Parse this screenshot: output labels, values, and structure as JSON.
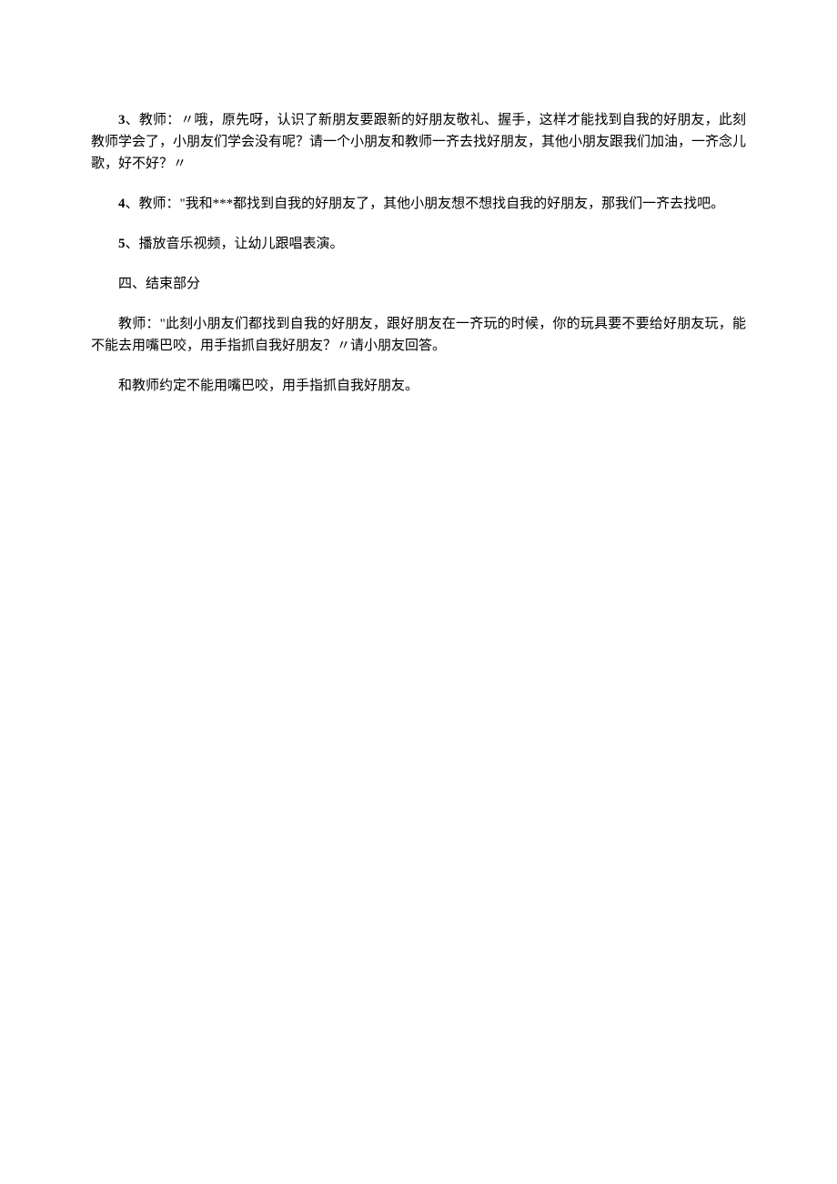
{
  "paragraphs": {
    "p1_num": "3",
    "p1_text": "、教师：〃哦，原先呀，认识了新朋友要跟新的好朋友敬礼、握手，这样才能找到自我的好朋友，此刻教师学会了，小朋友们学会没有呢？请一个小朋友和教师一齐去找好朋友，其他小朋友跟我们加油，一齐念儿歌，好不好？〃",
    "p2_num": "4",
    "p2_text": "、教师：\"我和***都找到自我的好朋友了，其他小朋友想不想找自我的好朋友，那我们一齐去找吧。",
    "p3_num": "5",
    "p3_text": "、播放音乐视频，让幼儿跟唱表演。",
    "p4_text": "四、结束部分",
    "p5_text": "教师：\"此刻小朋友们都找到自我的好朋友，跟好朋友在一齐玩的时候，你的玩具要不要给好朋友玩，能不能去用嘴巴咬，用手指抓自我好朋友？〃请小朋友回答。",
    "p6_text": "和教师约定不能用嘴巴咬，用手指抓自我好朋友。"
  }
}
